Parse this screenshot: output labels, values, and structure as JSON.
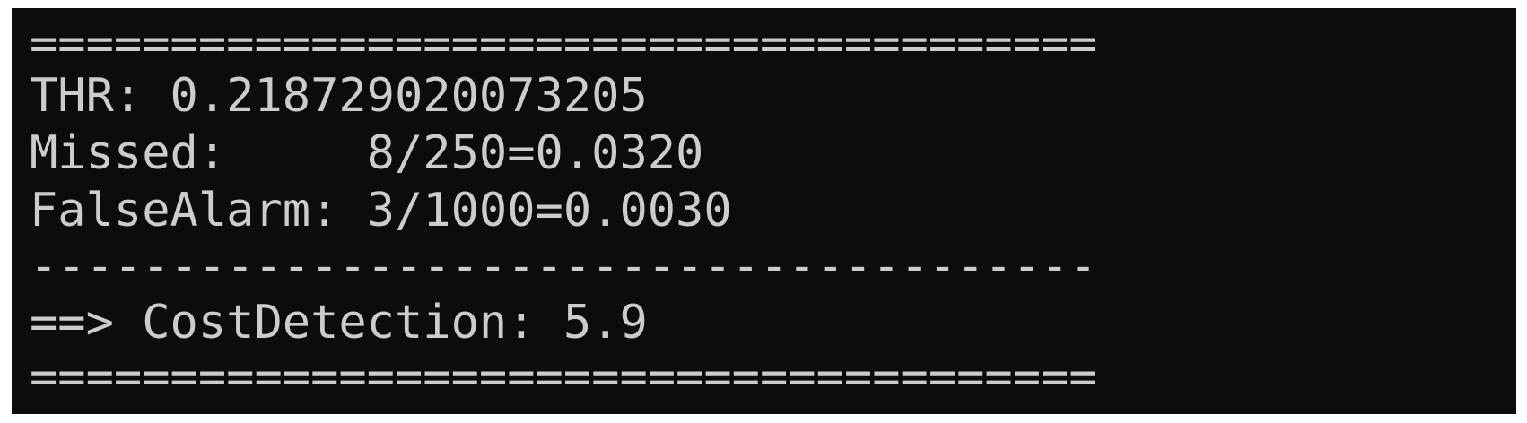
{
  "terminal": {
    "lines": [
      "======================================",
      "THR: 0.218729020073205",
      "Missed:     8/250=0.0320",
      "FalseAlarm: 3/1000=0.0030",
      "--------------------------------------",
      "==> CostDetection: 5.9",
      "======================================"
    ]
  }
}
